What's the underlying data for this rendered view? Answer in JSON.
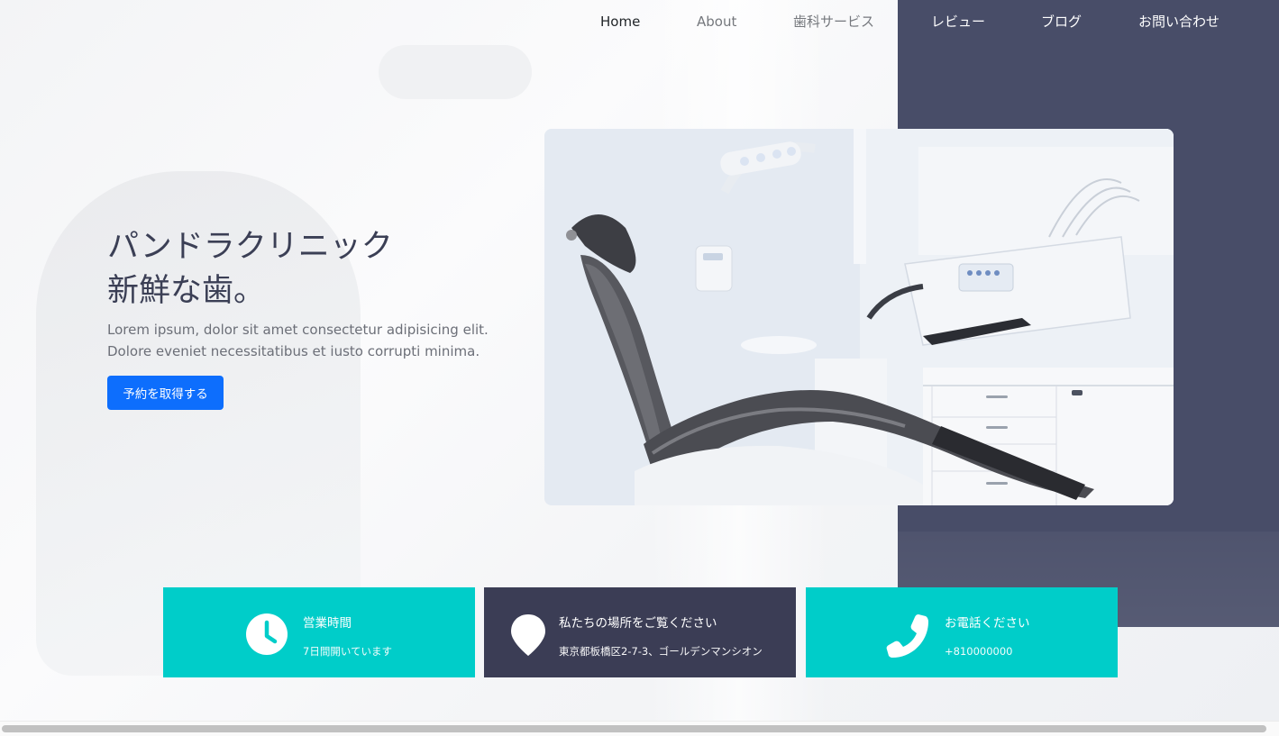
{
  "nav": {
    "items": [
      {
        "label": "Home"
      },
      {
        "label": "About"
      },
      {
        "label": "歯科サービス"
      },
      {
        "label": "レビュー"
      },
      {
        "label": "ブログ"
      },
      {
        "label": "お問い合わせ"
      }
    ]
  },
  "hero": {
    "title_line1": "パンドラクリニック",
    "title_line2": "新鮮な歯。",
    "text_line1": "Lorem ipsum, dolor sit amet consectetur adipisicing elit.",
    "text_line2": "Dolore eveniet necessitatibus et iusto corrupti minima.",
    "cta_label": "予約を取得する"
  },
  "cards": [
    {
      "title": "営業時間",
      "subtitle": "7日間開いています",
      "icon": "clock-icon",
      "color": "#00cdc9"
    },
    {
      "title": "私たちの場所をご覧ください",
      "subtitle": "東京都板橋区2-7-3、ゴールデンマンシオン",
      "icon": "map-pin-icon",
      "color": "#3b3d55"
    },
    {
      "title": "お電話ください",
      "subtitle": "+810000000",
      "icon": "phone-icon",
      "color": "#00cdc9"
    }
  ],
  "colors": {
    "accent": "#0d6efd",
    "teal": "#00cdc9",
    "navy": "#3b3d55",
    "panel": "#484d68"
  }
}
